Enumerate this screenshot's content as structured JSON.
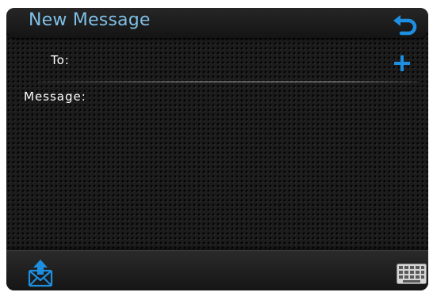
{
  "header": {
    "title": "New Message",
    "back_icon": "back-arrow-icon"
  },
  "compose": {
    "to_label": "To:",
    "add_recipient_icon": "plus-icon",
    "message_label": "Message:",
    "message_value": ""
  },
  "footer": {
    "send_icon": "send-envelope-icon",
    "keyboard_icon": "keyboard-icon"
  },
  "colors": {
    "accent": "#1e8fe0",
    "title_text": "#7fc0e6",
    "label_text": "#ffffff",
    "background": "#1c1c1c"
  }
}
